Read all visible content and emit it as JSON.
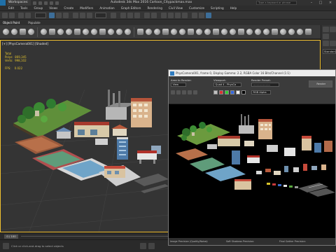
{
  "titlebar": {
    "workspace": "Workspaces: Default",
    "title": "Autodesk 3ds Max 2016    Cartoon_Citypackmax.max",
    "search_placeholder": "Type a keyword or phrase"
  },
  "menu": [
    "Edit",
    "Tools",
    "Group",
    "Views",
    "Create",
    "Modifiers",
    "Animation",
    "Graph Editors",
    "Rendering",
    "Civil View",
    "Customize",
    "Scripting",
    "Help"
  ],
  "ribbon": {
    "tabs": [
      "Object Paint",
      "Populate"
    ],
    "selected": "Object Paint"
  },
  "viewport": {
    "label": "[+] [PhysCamera001] [Shaded]",
    "stats": [
      "Total",
      "Polys:  869,345",
      "Verts:  998,102",
      "",
      "FPS:    0.022"
    ]
  },
  "cmdpanel": {
    "field_name": "Standard"
  },
  "timeline": {
    "frame": "0 / 100"
  },
  "statusbar": {
    "hint": "Click or click-and-drag to select objects"
  },
  "render_window": {
    "title": "PhysCamera001, frame 0, Display Gamma: 2.2, RGBA Color 16 Bits/Channel (1:1)",
    "area_label": "Area to Render:",
    "area_value": "View",
    "viewport_label": "Viewport:",
    "viewport_value": "Quad 4 - PhysCa",
    "preset_label": "Render Preset:",
    "preset_value": "-------------------",
    "channel_value": "RGB Alpha",
    "render_button": "Render",
    "status_left": "Image Precision (Quality/Noise):",
    "status_mid": "Soft Shadows Precision:",
    "status_right": "Final Gather Precision:"
  },
  "colors": {
    "accent": "#f0c030",
    "viewport_bg": "#343434",
    "render_bg": "#000000"
  }
}
